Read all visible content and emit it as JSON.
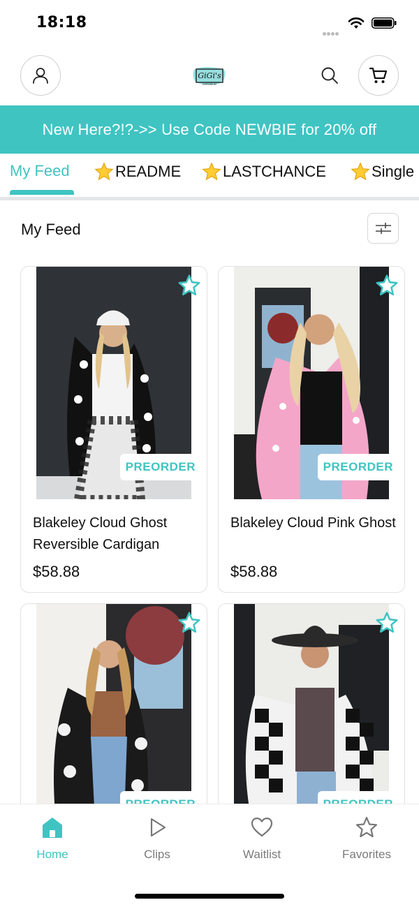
{
  "status_bar": {
    "time": "18:18"
  },
  "header": {
    "logo_text": "GiGi's",
    "logo_subtext": "EMPORIUM",
    "icons": [
      "profile-icon",
      "search-icon",
      "cart-icon"
    ]
  },
  "promo": {
    "text": "New Here?!?->> Use Code NEWBIE for 20% off"
  },
  "tabs": [
    {
      "label": "My Feed",
      "active": true,
      "star": false
    },
    {
      "label": "README",
      "active": false,
      "star": true
    },
    {
      "label": "LASTCHANCE",
      "active": false,
      "star": true
    },
    {
      "label": "Single",
      "active": false,
      "star": true
    }
  ],
  "feed": {
    "title": "My Feed"
  },
  "products": [
    {
      "name": "Blakeley Cloud Ghost Reversible Cardigan",
      "price": "$58.88",
      "badge": "PREORDER",
      "image": "woman-black-ghost-cardigan-photo"
    },
    {
      "name": "Blakeley Cloud Pink Ghost",
      "price": "$58.88",
      "badge": "PREORDER",
      "image": "woman-pink-ghost-cardigan-photo"
    },
    {
      "name": "",
      "price": "",
      "badge": "PREORDER",
      "image": "woman-pumpkin-cardigan-photo"
    },
    {
      "name": "",
      "price": "",
      "badge": "PREORDER",
      "image": "woman-checkered-ghost-cardigan-photo"
    }
  ],
  "bottom_nav": [
    {
      "label": "Home",
      "icon": "home-icon",
      "active": true
    },
    {
      "label": "Clips",
      "icon": "play-icon",
      "active": false
    },
    {
      "label": "Waitlist",
      "icon": "heart-icon",
      "active": false
    },
    {
      "label": "Favorites",
      "icon": "star-icon",
      "active": false
    }
  ],
  "colors": {
    "accent": "#3fc4c2",
    "text": "#111111",
    "muted": "#7b7b7b"
  }
}
